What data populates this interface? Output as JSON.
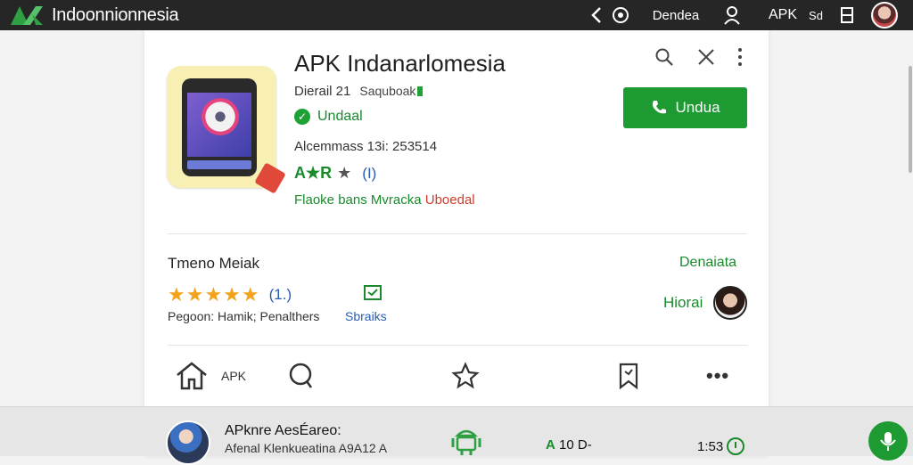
{
  "topbar": {
    "brand": "Indoonnionnesia",
    "back_icon": "chevron-left-icon",
    "help_icon": "help-icon",
    "link": "Dendea",
    "user_icon": "user-icon",
    "apk_label": "APK",
    "settings_label": "Sd",
    "book_icon": "book-icon"
  },
  "app": {
    "title": "APK Indanarlomesia",
    "developer": "Dierail 21",
    "developer_extra": "Saquboak",
    "verified_label": "Undaal",
    "meta": "Alcemmass 13i: 253514",
    "rating_text": "A★R",
    "rating_count": "(I)",
    "tag1": "Flaoke ",
    "tag2": "bans Mvracka ",
    "tag3": "Uboedal",
    "install_label": "Undua"
  },
  "reviews": {
    "title": "Tmeno Meiak",
    "link": "Denaiata",
    "stars": "★★★★★",
    "count": "(1.)",
    "label": "Pegoon: Hamik; Penalthers",
    "link2": "Sbraiks",
    "reviewer": "Hiorai"
  },
  "nav": {
    "home_label": "APK"
  },
  "bottom": {
    "title": "APknre AesÉareo:",
    "subtitle": "Afenal Klenkueatina A9A12 A",
    "a_label": "A",
    "a_value": "10 D-",
    "time": "1:53"
  },
  "colors": {
    "primary_green": "#1e9a32",
    "topbar": "#262626",
    "link_blue": "#2a5db0",
    "star_orange": "#f2a31b",
    "accent_red": "#d03b2b"
  }
}
